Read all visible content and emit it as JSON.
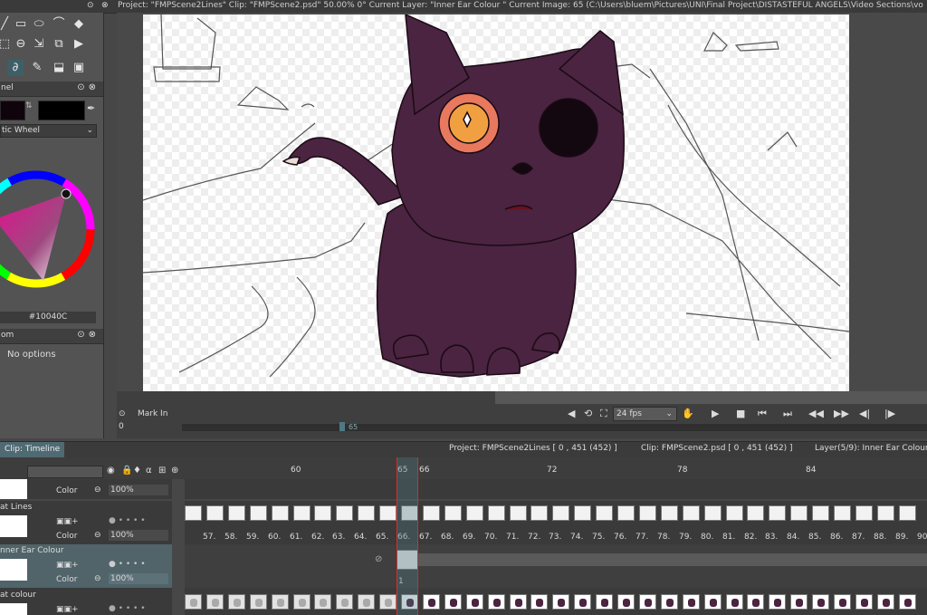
{
  "titlebar": {
    "text": "Project: \"FMPScene2Lines\"  Clip: \"FMPScene2.psd\"   50.00%   0°  Current Layer: \"Inner Ear Colour \"   Current Image: 65 (C:\\Users\\bluem\\Pictures\\UNI\\Final Project\\DISTASTEFUL ANGELS\\Video Sections\\vo"
  },
  "color_panel": {
    "title": "nel",
    "mode": "tic Wheel",
    "hex": "#10040C",
    "fg_color": "#10040c",
    "bg_color": "#000000"
  },
  "options_panel": {
    "title": "om",
    "text": "No options"
  },
  "playback": {
    "mark_in": "Mark In",
    "frame_value": "0",
    "fps": "24 fps",
    "ruler_marker": "65"
  },
  "timeline": {
    "tab": "Clip: Timeline",
    "project_info": "Project: FMPScene2Lines [ 0 , 451  (452) ]",
    "clip_info": "Clip: FMPScene2.psd [ 0 , 451  (452) ]",
    "layer_info": "Layer(5/9): Inner Ear Colour",
    "ruler_labels": [
      "60",
      "65",
      "66",
      "72",
      "78",
      "84"
    ],
    "frame_numbers": [
      "57.",
      "58.",
      "59.",
      "60.",
      "61.",
      "62.",
      "63.",
      "64.",
      "65.",
      "66.",
      "67.",
      "68.",
      "69.",
      "70.",
      "71.",
      "72.",
      "73.",
      "74.",
      "75.",
      "76.",
      "77.",
      "78.",
      "79.",
      "80.",
      "81.",
      "82.",
      "83.",
      "84.",
      "85.",
      "86.",
      "87.",
      "88.",
      "89.",
      "90."
    ],
    "layers": [
      {
        "name": "",
        "blend": "Color",
        "opacity": "100%"
      },
      {
        "name": "at Lines",
        "blend": "Color",
        "opacity": "100%"
      },
      {
        "name": "nner Ear Colour",
        "blend": "Color",
        "opacity": "100%",
        "cel": "1"
      },
      {
        "name": "at colour",
        "blend": "",
        "opacity": ""
      }
    ],
    "playhead_color": "#d03030",
    "accent": "#4f6a72"
  },
  "icons": {
    "tools": [
      "line-tool-icon",
      "rectangle-tool-icon",
      "ellipse-tool-icon",
      "lasso-tool-icon",
      "eraser-tool-icon",
      "select-tool-icon",
      "zoom-tool-icon",
      "transform-tool-icon",
      "layer-tool-icon",
      "camera-tool-icon",
      "bone-tool-icon",
      "brush-tool-icon",
      "fill-tool-icon",
      "stamp-tool-icon"
    ]
  }
}
